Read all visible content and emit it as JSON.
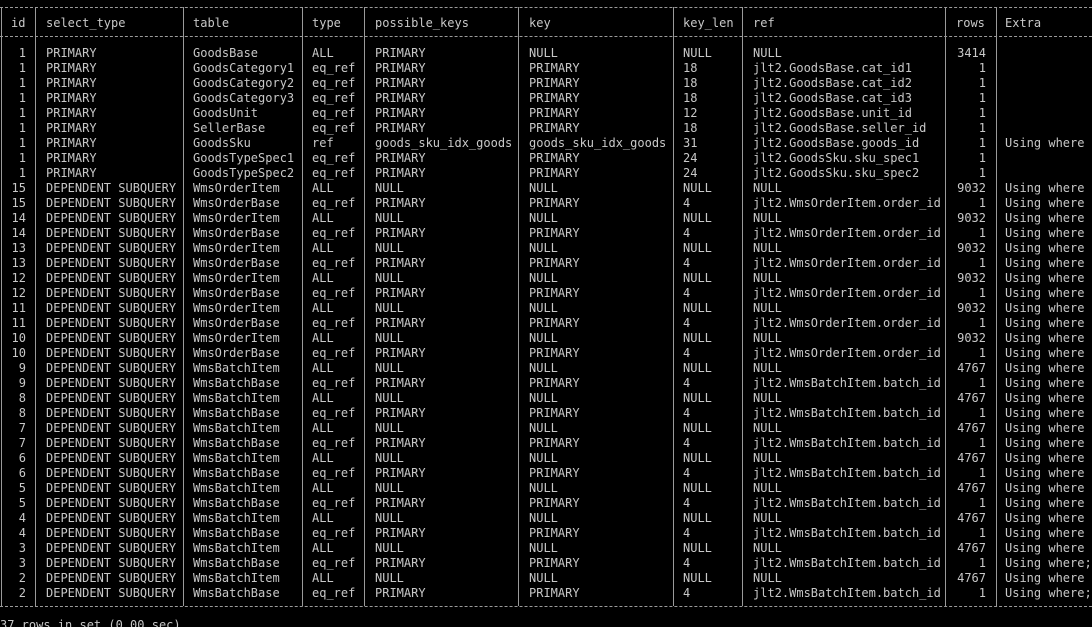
{
  "headers": {
    "id": "id",
    "select_type": "select_type",
    "table": "table",
    "type": "type",
    "possible_keys": "possible_keys",
    "key": "key",
    "key_len": "key_len",
    "ref": "ref",
    "rows": "rows",
    "extra": "Extra"
  },
  "rows": [
    {
      "id": "1",
      "select_type": "PRIMARY",
      "table": "GoodsBase",
      "type": "ALL",
      "possible_keys": "PRIMARY",
      "key": "NULL",
      "key_len": "NULL",
      "ref": "NULL",
      "rows": "3414",
      "extra": ""
    },
    {
      "id": "1",
      "select_type": "PRIMARY",
      "table": "GoodsCategory1",
      "type": "eq_ref",
      "possible_keys": "PRIMARY",
      "key": "PRIMARY",
      "key_len": "18",
      "ref": "jlt2.GoodsBase.cat_id1",
      "rows": "1",
      "extra": ""
    },
    {
      "id": "1",
      "select_type": "PRIMARY",
      "table": "GoodsCategory2",
      "type": "eq_ref",
      "possible_keys": "PRIMARY",
      "key": "PRIMARY",
      "key_len": "18",
      "ref": "jlt2.GoodsBase.cat_id2",
      "rows": "1",
      "extra": ""
    },
    {
      "id": "1",
      "select_type": "PRIMARY",
      "table": "GoodsCategory3",
      "type": "eq_ref",
      "possible_keys": "PRIMARY",
      "key": "PRIMARY",
      "key_len": "18",
      "ref": "jlt2.GoodsBase.cat_id3",
      "rows": "1",
      "extra": ""
    },
    {
      "id": "1",
      "select_type": "PRIMARY",
      "table": "GoodsUnit",
      "type": "eq_ref",
      "possible_keys": "PRIMARY",
      "key": "PRIMARY",
      "key_len": "12",
      "ref": "jlt2.GoodsBase.unit_id",
      "rows": "1",
      "extra": ""
    },
    {
      "id": "1",
      "select_type": "PRIMARY",
      "table": "SellerBase",
      "type": "eq_ref",
      "possible_keys": "PRIMARY",
      "key": "PRIMARY",
      "key_len": "18",
      "ref": "jlt2.GoodsBase.seller_id",
      "rows": "1",
      "extra": ""
    },
    {
      "id": "1",
      "select_type": "PRIMARY",
      "table": "GoodsSku",
      "type": "ref",
      "possible_keys": "goods_sku_idx_goods",
      "key": "goods_sku_idx_goods",
      "key_len": "31",
      "ref": "jlt2.GoodsBase.goods_id",
      "rows": "1",
      "extra": "Using where"
    },
    {
      "id": "1",
      "select_type": "PRIMARY",
      "table": "GoodsTypeSpec1",
      "type": "eq_ref",
      "possible_keys": "PRIMARY",
      "key": "PRIMARY",
      "key_len": "24",
      "ref": "jlt2.GoodsSku.sku_spec1",
      "rows": "1",
      "extra": ""
    },
    {
      "id": "1",
      "select_type": "PRIMARY",
      "table": "GoodsTypeSpec2",
      "type": "eq_ref",
      "possible_keys": "PRIMARY",
      "key": "PRIMARY",
      "key_len": "24",
      "ref": "jlt2.GoodsSku.sku_spec2",
      "rows": "1",
      "extra": ""
    },
    {
      "id": "15",
      "select_type": "DEPENDENT SUBQUERY",
      "table": "WmsOrderItem",
      "type": "ALL",
      "possible_keys": "NULL",
      "key": "NULL",
      "key_len": "NULL",
      "ref": "NULL",
      "rows": "9032",
      "extra": "Using where"
    },
    {
      "id": "15",
      "select_type": "DEPENDENT SUBQUERY",
      "table": "WmsOrderBase",
      "type": "eq_ref",
      "possible_keys": "PRIMARY",
      "key": "PRIMARY",
      "key_len": "4",
      "ref": "jlt2.WmsOrderItem.order_id",
      "rows": "1",
      "extra": "Using where"
    },
    {
      "id": "14",
      "select_type": "DEPENDENT SUBQUERY",
      "table": "WmsOrderItem",
      "type": "ALL",
      "possible_keys": "NULL",
      "key": "NULL",
      "key_len": "NULL",
      "ref": "NULL",
      "rows": "9032",
      "extra": "Using where"
    },
    {
      "id": "14",
      "select_type": "DEPENDENT SUBQUERY",
      "table": "WmsOrderBase",
      "type": "eq_ref",
      "possible_keys": "PRIMARY",
      "key": "PRIMARY",
      "key_len": "4",
      "ref": "jlt2.WmsOrderItem.order_id",
      "rows": "1",
      "extra": "Using where"
    },
    {
      "id": "13",
      "select_type": "DEPENDENT SUBQUERY",
      "table": "WmsOrderItem",
      "type": "ALL",
      "possible_keys": "NULL",
      "key": "NULL",
      "key_len": "NULL",
      "ref": "NULL",
      "rows": "9032",
      "extra": "Using where"
    },
    {
      "id": "13",
      "select_type": "DEPENDENT SUBQUERY",
      "table": "WmsOrderBase",
      "type": "eq_ref",
      "possible_keys": "PRIMARY",
      "key": "PRIMARY",
      "key_len": "4",
      "ref": "jlt2.WmsOrderItem.order_id",
      "rows": "1",
      "extra": "Using where"
    },
    {
      "id": "12",
      "select_type": "DEPENDENT SUBQUERY",
      "table": "WmsOrderItem",
      "type": "ALL",
      "possible_keys": "NULL",
      "key": "NULL",
      "key_len": "NULL",
      "ref": "NULL",
      "rows": "9032",
      "extra": "Using where"
    },
    {
      "id": "12",
      "select_type": "DEPENDENT SUBQUERY",
      "table": "WmsOrderBase",
      "type": "eq_ref",
      "possible_keys": "PRIMARY",
      "key": "PRIMARY",
      "key_len": "4",
      "ref": "jlt2.WmsOrderItem.order_id",
      "rows": "1",
      "extra": "Using where"
    },
    {
      "id": "11",
      "select_type": "DEPENDENT SUBQUERY",
      "table": "WmsOrderItem",
      "type": "ALL",
      "possible_keys": "NULL",
      "key": "NULL",
      "key_len": "NULL",
      "ref": "NULL",
      "rows": "9032",
      "extra": "Using where"
    },
    {
      "id": "11",
      "select_type": "DEPENDENT SUBQUERY",
      "table": "WmsOrderBase",
      "type": "eq_ref",
      "possible_keys": "PRIMARY",
      "key": "PRIMARY",
      "key_len": "4",
      "ref": "jlt2.WmsOrderItem.order_id",
      "rows": "1",
      "extra": "Using where"
    },
    {
      "id": "10",
      "select_type": "DEPENDENT SUBQUERY",
      "table": "WmsOrderItem",
      "type": "ALL",
      "possible_keys": "NULL",
      "key": "NULL",
      "key_len": "NULL",
      "ref": "NULL",
      "rows": "9032",
      "extra": "Using where"
    },
    {
      "id": "10",
      "select_type": "DEPENDENT SUBQUERY",
      "table": "WmsOrderBase",
      "type": "eq_ref",
      "possible_keys": "PRIMARY",
      "key": "PRIMARY",
      "key_len": "4",
      "ref": "jlt2.WmsOrderItem.order_id",
      "rows": "1",
      "extra": "Using where"
    },
    {
      "id": "9",
      "select_type": "DEPENDENT SUBQUERY",
      "table": "WmsBatchItem",
      "type": "ALL",
      "possible_keys": "NULL",
      "key": "NULL",
      "key_len": "NULL",
      "ref": "NULL",
      "rows": "4767",
      "extra": "Using where"
    },
    {
      "id": "9",
      "select_type": "DEPENDENT SUBQUERY",
      "table": "WmsBatchBase",
      "type": "eq_ref",
      "possible_keys": "PRIMARY",
      "key": "PRIMARY",
      "key_len": "4",
      "ref": "jlt2.WmsBatchItem.batch_id",
      "rows": "1",
      "extra": "Using where"
    },
    {
      "id": "8",
      "select_type": "DEPENDENT SUBQUERY",
      "table": "WmsBatchItem",
      "type": "ALL",
      "possible_keys": "NULL",
      "key": "NULL",
      "key_len": "NULL",
      "ref": "NULL",
      "rows": "4767",
      "extra": "Using where"
    },
    {
      "id": "8",
      "select_type": "DEPENDENT SUBQUERY",
      "table": "WmsBatchBase",
      "type": "eq_ref",
      "possible_keys": "PRIMARY",
      "key": "PRIMARY",
      "key_len": "4",
      "ref": "jlt2.WmsBatchItem.batch_id",
      "rows": "1",
      "extra": "Using where"
    },
    {
      "id": "7",
      "select_type": "DEPENDENT SUBQUERY",
      "table": "WmsBatchItem",
      "type": "ALL",
      "possible_keys": "NULL",
      "key": "NULL",
      "key_len": "NULL",
      "ref": "NULL",
      "rows": "4767",
      "extra": "Using where"
    },
    {
      "id": "7",
      "select_type": "DEPENDENT SUBQUERY",
      "table": "WmsBatchBase",
      "type": "eq_ref",
      "possible_keys": "PRIMARY",
      "key": "PRIMARY",
      "key_len": "4",
      "ref": "jlt2.WmsBatchItem.batch_id",
      "rows": "1",
      "extra": "Using where"
    },
    {
      "id": "6",
      "select_type": "DEPENDENT SUBQUERY",
      "table": "WmsBatchItem",
      "type": "ALL",
      "possible_keys": "NULL",
      "key": "NULL",
      "key_len": "NULL",
      "ref": "NULL",
      "rows": "4767",
      "extra": "Using where"
    },
    {
      "id": "6",
      "select_type": "DEPENDENT SUBQUERY",
      "table": "WmsBatchBase",
      "type": "eq_ref",
      "possible_keys": "PRIMARY",
      "key": "PRIMARY",
      "key_len": "4",
      "ref": "jlt2.WmsBatchItem.batch_id",
      "rows": "1",
      "extra": "Using where"
    },
    {
      "id": "5",
      "select_type": "DEPENDENT SUBQUERY",
      "table": "WmsBatchItem",
      "type": "ALL",
      "possible_keys": "NULL",
      "key": "NULL",
      "key_len": "NULL",
      "ref": "NULL",
      "rows": "4767",
      "extra": "Using where"
    },
    {
      "id": "5",
      "select_type": "DEPENDENT SUBQUERY",
      "table": "WmsBatchBase",
      "type": "eq_ref",
      "possible_keys": "PRIMARY",
      "key": "PRIMARY",
      "key_len": "4",
      "ref": "jlt2.WmsBatchItem.batch_id",
      "rows": "1",
      "extra": "Using where"
    },
    {
      "id": "4",
      "select_type": "DEPENDENT SUBQUERY",
      "table": "WmsBatchItem",
      "type": "ALL",
      "possible_keys": "NULL",
      "key": "NULL",
      "key_len": "NULL",
      "ref": "NULL",
      "rows": "4767",
      "extra": "Using where"
    },
    {
      "id": "4",
      "select_type": "DEPENDENT SUBQUERY",
      "table": "WmsBatchBase",
      "type": "eq_ref",
      "possible_keys": "PRIMARY",
      "key": "PRIMARY",
      "key_len": "4",
      "ref": "jlt2.WmsBatchItem.batch_id",
      "rows": "1",
      "extra": "Using where"
    },
    {
      "id": "3",
      "select_type": "DEPENDENT SUBQUERY",
      "table": "WmsBatchItem",
      "type": "ALL",
      "possible_keys": "NULL",
      "key": "NULL",
      "key_len": "NULL",
      "ref": "NULL",
      "rows": "4767",
      "extra": "Using where"
    },
    {
      "id": "3",
      "select_type": "DEPENDENT SUBQUERY",
      "table": "WmsBatchBase",
      "type": "eq_ref",
      "possible_keys": "PRIMARY",
      "key": "PRIMARY",
      "key_len": "4",
      "ref": "jlt2.WmsBatchItem.batch_id",
      "rows": "1",
      "extra": "Using where;"
    },
    {
      "id": "2",
      "select_type": "DEPENDENT SUBQUERY",
      "table": "WmsBatchItem",
      "type": "ALL",
      "possible_keys": "NULL",
      "key": "NULL",
      "key_len": "NULL",
      "ref": "NULL",
      "rows": "4767",
      "extra": "Using where"
    },
    {
      "id": "2",
      "select_type": "DEPENDENT SUBQUERY",
      "table": "WmsBatchBase",
      "type": "eq_ref",
      "possible_keys": "PRIMARY",
      "key": "PRIMARY",
      "key_len": "4",
      "ref": "jlt2.WmsBatchItem.batch_id",
      "rows": "1",
      "extra": "Using where;"
    }
  ],
  "footer": "37 rows in set (0.00 sec)"
}
